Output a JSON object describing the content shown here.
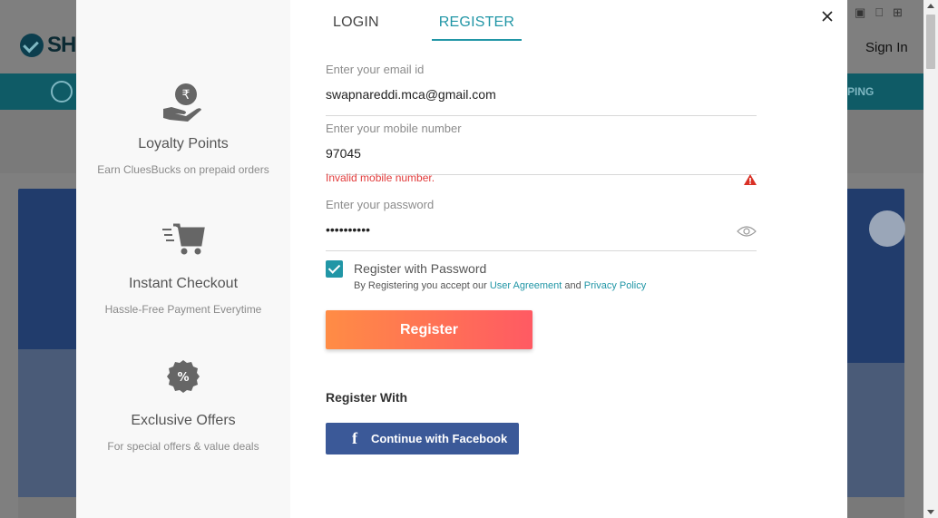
{
  "background": {
    "logo_text": "SHO",
    "signin_label": "Sign In",
    "nav_right_text": "PING"
  },
  "modal": {
    "tabs": [
      {
        "label": "LOGIN",
        "active": false
      },
      {
        "label": "REGISTER",
        "active": true
      }
    ],
    "features": [
      {
        "icon": "rupee-hand-icon",
        "title": "Loyalty Points",
        "desc": "Earn CluesBucks on prepaid orders"
      },
      {
        "icon": "cart-icon",
        "title": "Instant Checkout",
        "desc": "Hassle-Free Payment Everytime"
      },
      {
        "icon": "percent-badge-icon",
        "title": "Exclusive Offers",
        "desc": "For special offers & value deals"
      }
    ],
    "email": {
      "label": "Enter your email id",
      "value": "swapnareddi.mca@gmail.com"
    },
    "mobile": {
      "label": "Enter your mobile number",
      "value": "97045",
      "error": "Invalid mobile number."
    },
    "password": {
      "label": "Enter your password",
      "value": "••••••••••"
    },
    "register_with_password": {
      "label": "Register with Password",
      "checked": true
    },
    "agreement": {
      "prefix": "By Registering you accept our ",
      "user_agreement": "User Agreement",
      "and": " and ",
      "privacy_policy": "Privacy Policy"
    },
    "register_button": "Register",
    "register_with_label": "Register With",
    "facebook_button": "Continue with Facebook"
  },
  "colors": {
    "accent": "#2196a6",
    "error": "#e23b3b",
    "facebook": "#3b5998",
    "register_gradient_start": "#ff8c45",
    "register_gradient_end": "#ff5a63"
  }
}
